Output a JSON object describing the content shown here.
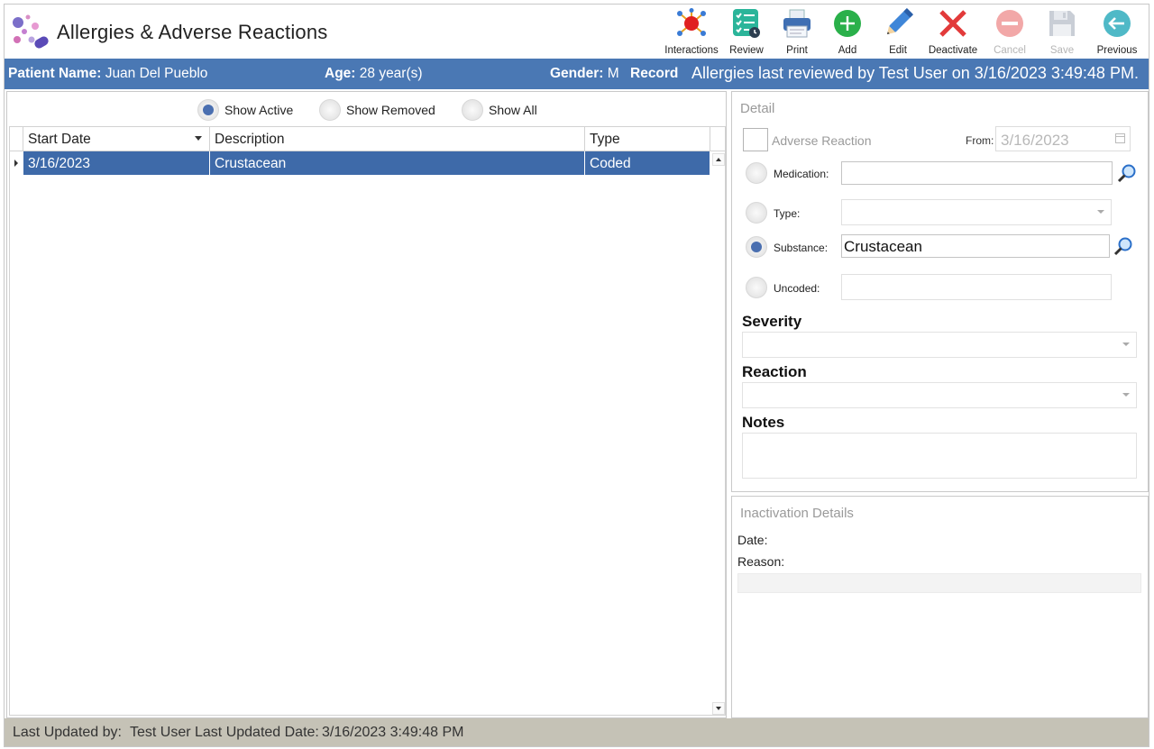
{
  "app": {
    "title": "Allergies & Adverse Reactions"
  },
  "toolbar": {
    "interactions": "Interactions",
    "review": "Review",
    "print": "Print",
    "add": "Add",
    "edit": "Edit",
    "deactivate": "Deactivate",
    "cancel": "Cancel",
    "save": "Save",
    "previous": "Previous"
  },
  "patient": {
    "name_label": "Patient Name:",
    "name": "Juan Del Pueblo",
    "age_label": "Age:",
    "age": "28 year(s)",
    "gender_label": "Gender:",
    "gender": "M",
    "record_label": "Record",
    "review_text": "Allergies last reviewed by Test User on 3/16/2023 3:49:48 PM."
  },
  "filters": {
    "active": "Show Active",
    "removed": "Show Removed",
    "all": "Show All",
    "selected": "active"
  },
  "grid": {
    "columns": [
      "Start Date",
      "Description",
      "Type"
    ],
    "rows": [
      {
        "start_date": "3/16/2023",
        "description": "Crustacean",
        "type": "Coded"
      }
    ]
  },
  "detail": {
    "caption": "Detail",
    "adverse_reaction": "Adverse Reaction",
    "from_label": "From:",
    "from_value": "3/16/2023",
    "medication_label": "Medication:",
    "medication_value": "",
    "type_label": "Type:",
    "type_value": "",
    "substance_label": "Substance:",
    "substance_value": "Crustacean",
    "uncoded_label": "Uncoded:",
    "uncoded_value": "",
    "severity_label": "Severity",
    "reaction_label": "Reaction",
    "notes_label": "Notes",
    "selected_source": "substance"
  },
  "inactivation": {
    "caption": "Inactivation Details",
    "date_label": "Date:",
    "reason_label": "Reason:"
  },
  "footer": {
    "updated_by_label": "Last Updated by:",
    "updated_by": "Test User",
    "updated_date_label": "Last Updated Date:",
    "updated_date": "3/16/2023 3:49:48 PM"
  },
  "colors": {
    "header_blue": "#4a78b4",
    "selection_blue": "#3e6aa9",
    "footer_bg": "#c5c2b6"
  }
}
